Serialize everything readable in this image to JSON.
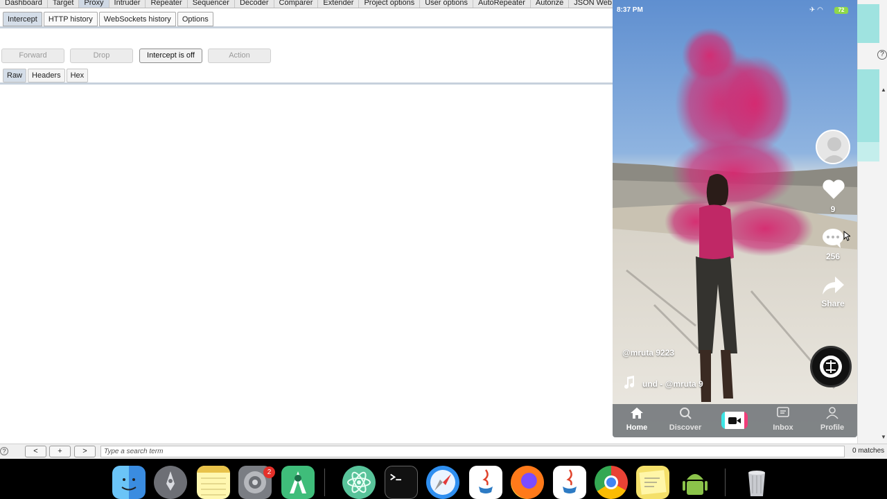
{
  "burp": {
    "top_tabs": [
      {
        "label": "Dashboard",
        "active": false
      },
      {
        "label": "Target",
        "active": false
      },
      {
        "label": "Proxy",
        "active": true
      },
      {
        "label": "Intruder",
        "active": false
      },
      {
        "label": "Repeater",
        "active": false
      },
      {
        "label": "Sequencer",
        "active": false
      },
      {
        "label": "Decoder",
        "active": false
      },
      {
        "label": "Comparer",
        "active": false
      },
      {
        "label": "Extender",
        "active": false
      },
      {
        "label": "Project options",
        "active": false
      },
      {
        "label": "User options",
        "active": false
      },
      {
        "label": "AutoRepeater",
        "active": false
      },
      {
        "label": "Autorize",
        "active": false
      },
      {
        "label": "JSON Web To",
        "active": false
      }
    ],
    "sub_tabs": [
      {
        "label": "Intercept",
        "active": true
      },
      {
        "label": "HTTP history",
        "active": false
      },
      {
        "label": "WebSockets history",
        "active": false
      },
      {
        "label": "Options",
        "active": false
      }
    ],
    "actions": {
      "forward": "Forward",
      "drop": "Drop",
      "intercept": "Intercept is off",
      "action": "Action"
    },
    "message_tabs": [
      {
        "label": "Raw",
        "active": true
      },
      {
        "label": "Headers",
        "active": false
      },
      {
        "label": "Hex",
        "active": false
      }
    ],
    "search": {
      "help": "?",
      "prev": "<",
      "add": "+",
      "next": ">",
      "placeholder": "Type a search term",
      "matches": "0 matches"
    }
  },
  "phone": {
    "status_time": "8:37 PM",
    "battery": "72",
    "likes": "9",
    "comments": "256",
    "share": "Share",
    "username": "@mruta 9223",
    "sound": "und - @mruta 9",
    "nav": {
      "home": "Home",
      "discover": "Discover",
      "inbox": "Inbox",
      "profile": "Profile"
    }
  },
  "dock": {
    "badge": "2",
    "icons": [
      "finder-icon",
      "launchpad-icon",
      "notes-icon",
      "system-preferences-icon",
      "android-studio-icon",
      "atom-icon",
      "terminal-icon",
      "safari-icon",
      "java-icon",
      "firefox-icon",
      "java-icon-2",
      "chrome-icon",
      "stickies-icon",
      "android-icon",
      "trash-icon"
    ]
  },
  "colors": {
    "accent_tab": "#d4dde8",
    "smoke_pink": "#d6286f",
    "cam_cyan": "#3ee6e6",
    "cam_pink": "#f03d79"
  }
}
